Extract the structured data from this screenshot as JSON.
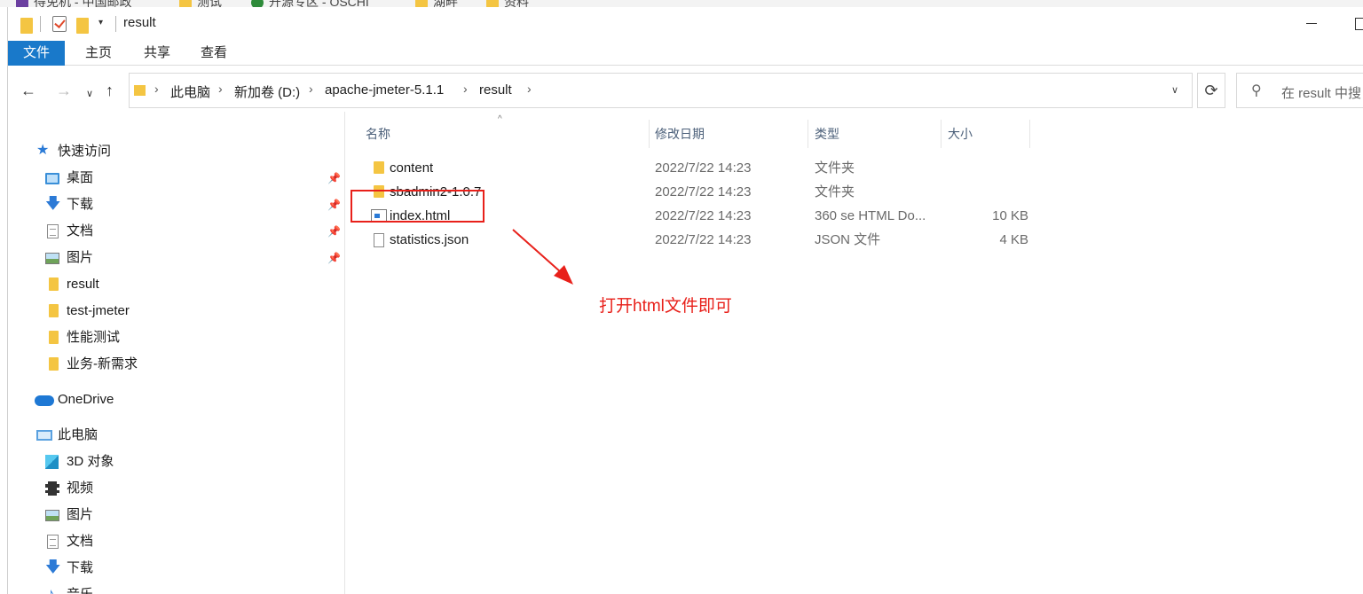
{
  "bookmarks": [
    "得免机 - 中国邮政",
    "测试",
    "开源专区 - OSCHI",
    "湖畔",
    "资料"
  ],
  "window": {
    "title": "result"
  },
  "ribbon": {
    "tabs": [
      "文件",
      "主页",
      "共享",
      "查看"
    ]
  },
  "address": {
    "breadcrumbs": [
      "此电脑",
      "新加卷 (D:)",
      "apache-jmeter-5.1.1",
      "result"
    ],
    "search_placeholder": "在 result 中搜"
  },
  "nav": {
    "quick_access": "快速访问",
    "quick_items": [
      {
        "label": "桌面",
        "icon": "desktop-icon",
        "pinned": true
      },
      {
        "label": "下载",
        "icon": "download-icon",
        "pinned": true
      },
      {
        "label": "文档",
        "icon": "document-icon",
        "pinned": true
      },
      {
        "label": "图片",
        "icon": "picture-icon",
        "pinned": true
      },
      {
        "label": "result",
        "icon": "folder-icon",
        "pinned": false
      },
      {
        "label": "test-jmeter",
        "icon": "folder-icon",
        "pinned": false
      },
      {
        "label": "性能测试",
        "icon": "folder-icon",
        "pinned": false
      },
      {
        "label": "业务-新需求",
        "icon": "folder-icon",
        "pinned": false
      }
    ],
    "onedrive": "OneDrive",
    "this_pc": "此电脑",
    "pc_items": [
      {
        "label": "3D 对象",
        "icon": "3d-objects-icon"
      },
      {
        "label": "视频",
        "icon": "video-icon"
      },
      {
        "label": "图片",
        "icon": "picture-icon"
      },
      {
        "label": "文档",
        "icon": "document-icon"
      },
      {
        "label": "下载",
        "icon": "download-icon"
      },
      {
        "label": "音乐",
        "icon": "music-icon"
      }
    ]
  },
  "columns": [
    "名称",
    "修改日期",
    "类型",
    "大小"
  ],
  "files": [
    {
      "name": "content",
      "date": "2022/7/22 14:23",
      "type": "文件夹",
      "size": "",
      "icon": "folder-icon"
    },
    {
      "name": "sbadmin2-1.0.7",
      "date": "2022/7/22 14:23",
      "type": "文件夹",
      "size": "",
      "icon": "folder-icon"
    },
    {
      "name": "index.html",
      "date": "2022/7/22 14:23",
      "type": "360 se HTML Do...",
      "size": "10 KB",
      "icon": "html-file-icon"
    },
    {
      "name": "statistics.json",
      "date": "2022/7/22 14:23",
      "type": "JSON 文件",
      "size": "4 KB",
      "icon": "json-file-icon"
    }
  ],
  "annotation": "打开html文件即可",
  "colors": {
    "accent": "#1979ca",
    "annotation_red": "#e8201a",
    "folder_yellow": "#f4c542"
  }
}
